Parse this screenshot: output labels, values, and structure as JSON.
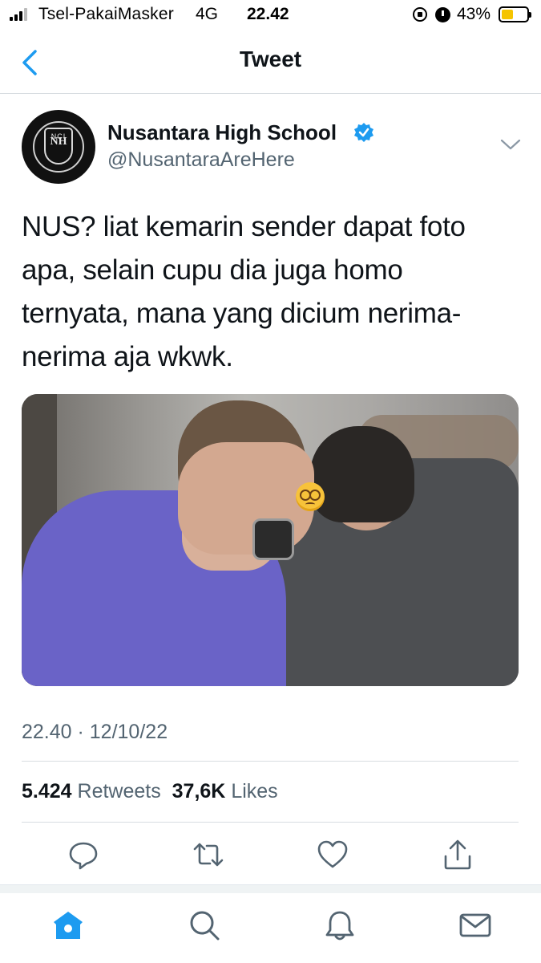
{
  "status_bar": {
    "carrier": "Tsel-PakaiMasker",
    "network": "4G",
    "time": "22.42",
    "battery": "43%",
    "battery_level": 0.43
  },
  "nav": {
    "title": "Tweet",
    "back_icon": "chevron-left-icon"
  },
  "tweet": {
    "author_name": "Nusantara High School",
    "handle": "@NusantaraAreHere",
    "avatar_mark": "NCI",
    "avatar_monogram": "NH",
    "verified": true,
    "text": "NUS? liat kemarin sender dapat foto apa, selain cupu dia juga homo ternyata, mana yang dicium nerima-nerima aja wkwk.",
    "timestamp": "22.40 · 12/10/22",
    "retweets_count": "5.424",
    "retweets_label": "Retweets",
    "likes_count": "37,6K",
    "likes_label": "Likes"
  },
  "actions": [
    "reply-icon",
    "retweet-icon",
    "like-icon",
    "share-icon"
  ],
  "tab_bar": [
    "home-icon",
    "search-icon",
    "notifications-icon",
    "messages-icon"
  ],
  "colors": {
    "accent": "#1d9bf0",
    "text_primary": "#0f1419",
    "text_secondary": "#536471",
    "battery_fill": "#f5c400"
  }
}
